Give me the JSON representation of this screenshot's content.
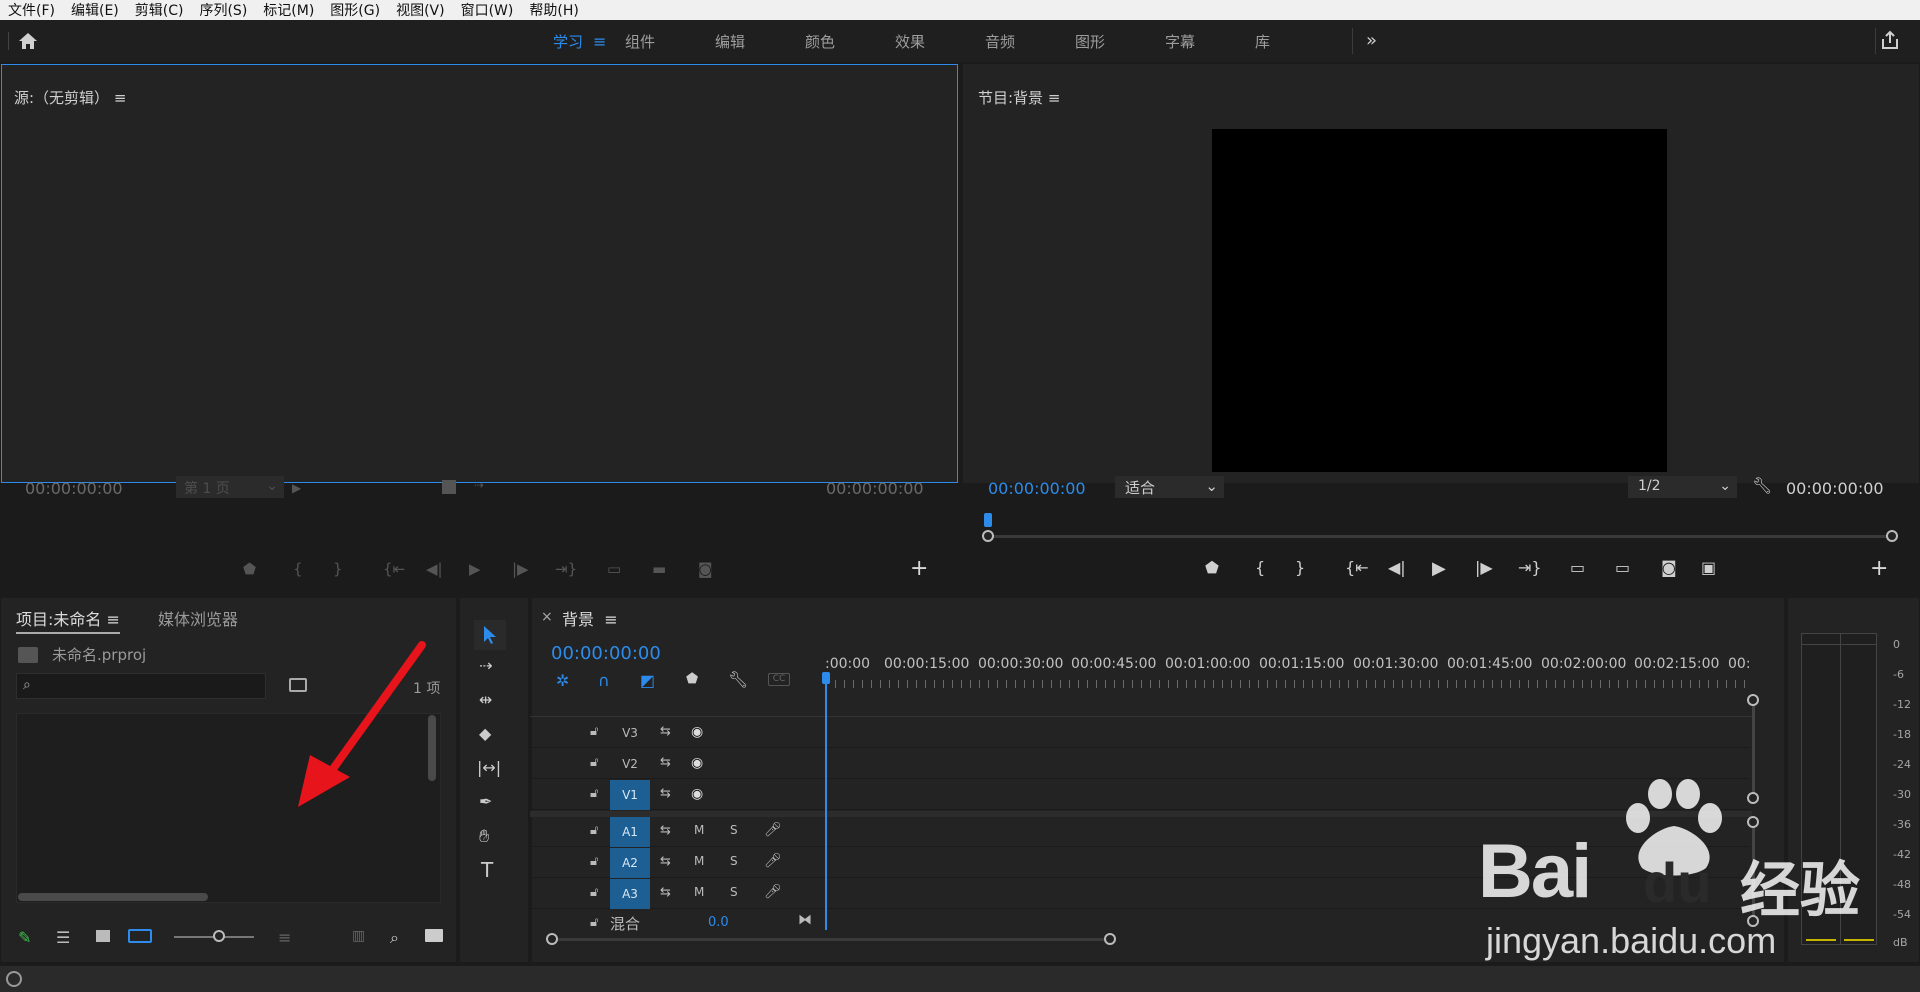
{
  "menu": [
    "文件(F)",
    "编辑(E)",
    "剪辑(C)",
    "序列(S)",
    "标记(M)",
    "图形(G)",
    "视图(V)",
    "窗口(W)",
    "帮助(H)"
  ],
  "workspaces": {
    "active": "学习",
    "tabs": [
      "组件",
      "编辑",
      "颜色",
      "效果",
      "音频",
      "图形",
      "字幕",
      "库"
    ]
  },
  "source": {
    "title": "源:（无剪辑）",
    "timecode_left": "00:00:00:00",
    "timecode_right": "00:00:00:00",
    "page": "第 1 页"
  },
  "program": {
    "title": "节目:背景",
    "timecode": "00:00:00:00",
    "timecode_right": "00:00:00:00",
    "fit": "适合",
    "resolution": "1/2"
  },
  "project": {
    "tab_project": "项目:未命名",
    "tab_media": "媒体浏览器",
    "filename": "未命名.prproj",
    "count": "1 项",
    "search_placeholder": ""
  },
  "timeline": {
    "title": "背景",
    "timecode": "00:00:00:00",
    "ruler": [
      ":00:00",
      "00:00:15:00",
      "00:00:30:00",
      "00:00:45:00",
      "00:01:00:00",
      "00:01:15:00",
      "00:01:30:00",
      "00:01:45:00",
      "00:02:00:00",
      "00:02:15:00",
      "00:"
    ],
    "video_tracks": [
      "V3",
      "V2",
      "V1"
    ],
    "audio_tracks": [
      "A1",
      "A2",
      "A3"
    ],
    "mute": "M",
    "solo": "S",
    "mix_label": "混合",
    "mix_value": "0.0"
  },
  "meter": {
    "scale": [
      "0",
      "-6",
      "-12",
      "-18",
      "-24",
      "-30",
      "-36",
      "-42",
      "-48",
      "-54",
      "dB"
    ]
  },
  "watermark": {
    "brand": "Bai",
    "brand2": "du",
    "cn": "经验",
    "url": "jingyan.baidu.com"
  },
  "colors": {
    "accent": "#2d8ceb",
    "track_selected": "#1d5f93",
    "annotation_arrow": "#e8141b"
  }
}
